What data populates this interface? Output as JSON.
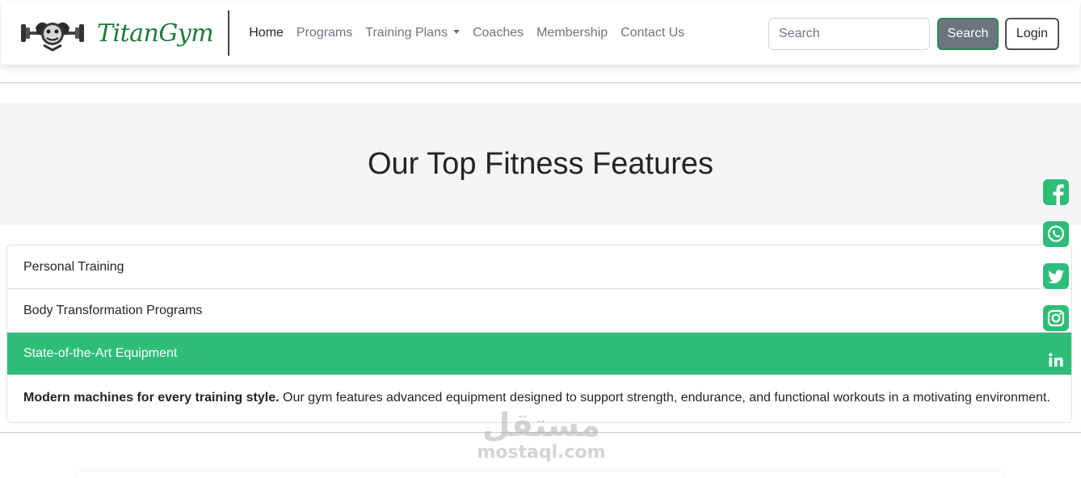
{
  "brand": {
    "name": "TitanGym",
    "logo_icon": "gym-mascot-logo"
  },
  "nav": {
    "items": [
      {
        "label": "Home",
        "active": true
      },
      {
        "label": "Programs"
      },
      {
        "label": "Training Plans",
        "dropdown": true
      },
      {
        "label": "Coaches"
      },
      {
        "label": "Membership"
      },
      {
        "label": "Contact Us"
      }
    ]
  },
  "search": {
    "placeholder": "Search",
    "button_label": "Search"
  },
  "login_label": "Login",
  "hero": {
    "title": "Our Top Fitness Features"
  },
  "accordion": {
    "items": [
      {
        "title": "Personal Training",
        "open": false
      },
      {
        "title": "Body Transformation Programs",
        "open": false
      },
      {
        "title": "State-of-the-Art Equipment",
        "open": true,
        "body_bold": "Modern machines for every training style.",
        "body_text": " Our gym features advanced equipment designed to support strength, endurance, and functional workouts in a motivating environment."
      }
    ]
  },
  "social": [
    "facebook-icon",
    "whatsapp-icon",
    "twitter-icon",
    "instagram-icon",
    "linkedin-icon"
  ],
  "colors": {
    "accent": "#2ebd78",
    "brand_text": "#1e7a3a",
    "muted": "#6c757d"
  },
  "watermark": {
    "arabic": "مستقل",
    "latin": "mostaql.com"
  }
}
